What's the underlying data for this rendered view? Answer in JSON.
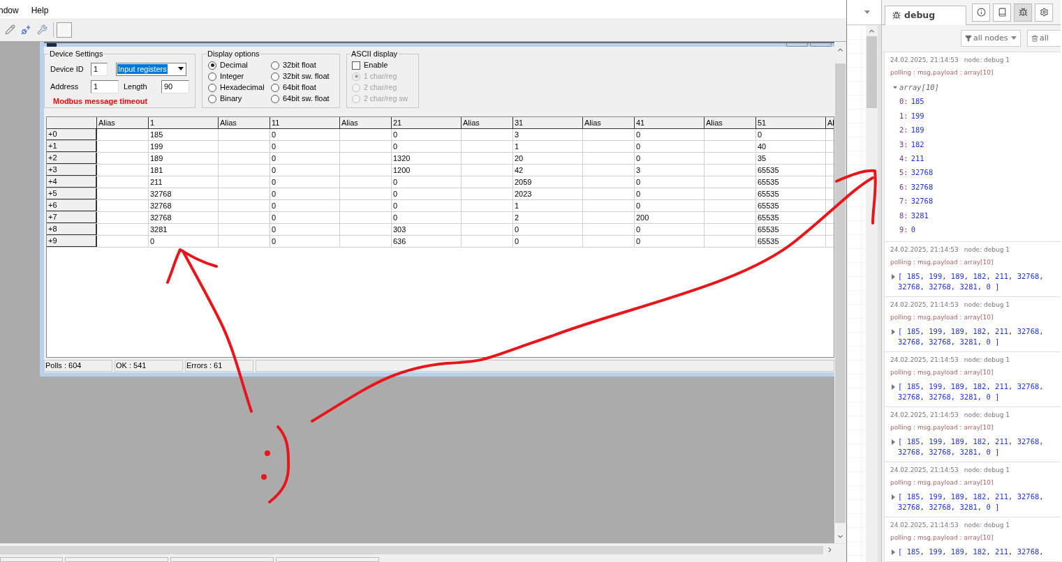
{
  "menu": [
    "ndow",
    "Help"
  ],
  "child_window": {
    "device_settings": {
      "title": "Device Settings",
      "device_id_label": "Device ID",
      "device_id": "1",
      "function": "Input registers",
      "address_label": "Address",
      "address": "1",
      "length_label": "Length",
      "length": "90",
      "error": "Modbus message timeout"
    },
    "display_options": {
      "title": "Display options",
      "options": [
        {
          "label": "Decimal",
          "selected": true
        },
        {
          "label": "Integer",
          "selected": false
        },
        {
          "label": "Hexadecimal",
          "selected": false
        },
        {
          "label": "Binary",
          "selected": false
        },
        {
          "label": "32bit float",
          "selected": false
        },
        {
          "label": "32bit sw. float",
          "selected": false
        },
        {
          "label": "64bit float",
          "selected": false
        },
        {
          "label": "64bit sw. float",
          "selected": false
        }
      ]
    },
    "ascii_display": {
      "title": "ASCII display",
      "enable": {
        "label": "Enable",
        "checked": false
      },
      "options": [
        {
          "label": "1 char/reg",
          "selected": true,
          "disabled": true
        },
        {
          "label": "2 char/reg",
          "selected": false,
          "disabled": true
        },
        {
          "label": "2 char/reg sw",
          "selected": false,
          "disabled": true
        }
      ]
    },
    "table": {
      "columns": [
        "Alias",
        "1",
        "Alias",
        "11",
        "Alias",
        "21",
        "Alias",
        "31",
        "Alias",
        "41",
        "Alias",
        "51",
        "Al"
      ],
      "rows": [
        {
          "label": "+0",
          "values": [
            "185",
            "0",
            "0",
            "3",
            "0",
            "0"
          ]
        },
        {
          "label": "+1",
          "values": [
            "199",
            "0",
            "0",
            "1",
            "0",
            "40"
          ]
        },
        {
          "label": "+2",
          "values": [
            "189",
            "0",
            "1320",
            "20",
            "0",
            "35"
          ]
        },
        {
          "label": "+3",
          "values": [
            "181",
            "0",
            "1200",
            "42",
            "3",
            "65535"
          ]
        },
        {
          "label": "+4",
          "values": [
            "211",
            "0",
            "0",
            "2059",
            "0",
            "65535"
          ]
        },
        {
          "label": "+5",
          "values": [
            "32768",
            "0",
            "0",
            "2023",
            "0",
            "65535"
          ]
        },
        {
          "label": "+6",
          "values": [
            "32768",
            "0",
            "0",
            "1",
            "0",
            "65535"
          ]
        },
        {
          "label": "+7",
          "values": [
            "32768",
            "0",
            "0",
            "2",
            "200",
            "65535"
          ]
        },
        {
          "label": "+8",
          "values": [
            "3281",
            "0",
            "303",
            "0",
            "0",
            "65535"
          ]
        },
        {
          "label": "+9",
          "values": [
            "0",
            "0",
            "636",
            "0",
            "0",
            "65535"
          ]
        }
      ]
    },
    "status_bar": [
      "Polls : 604",
      "OK : 541",
      "Errors : 61"
    ]
  },
  "debug_panel": {
    "tab": {
      "label": "debug",
      "selected": true
    },
    "tool_buttons": [
      {
        "kind": "info",
        "selected": false
      },
      {
        "kind": "book",
        "selected": false
      },
      {
        "kind": "bug",
        "selected": true
      },
      {
        "kind": "gear",
        "selected": false
      }
    ],
    "filter": "all nodes",
    "clear": "all",
    "messages": [
      {
        "time": "24.02.2025, 21:14:53",
        "node": "node: debug 1",
        "topic": "polling : msg.payload : array[10]",
        "expanded": true,
        "label": "array[10]",
        "items": [
          {
            "key": "0:",
            "value": "185"
          },
          {
            "key": "1:",
            "value": "199"
          },
          {
            "key": "2:",
            "value": "189"
          },
          {
            "key": "3:",
            "value": "182"
          },
          {
            "key": "4:",
            "value": "211"
          },
          {
            "key": "5:",
            "value": "32768"
          },
          {
            "key": "6:",
            "value": "32768"
          },
          {
            "key": "7:",
            "value": "32768"
          },
          {
            "key": "8:",
            "value": "3281"
          },
          {
            "key": "9:",
            "value": "0"
          }
        ]
      },
      {
        "time": "24.02.2025, 21:14:53",
        "node": "node: debug 1",
        "topic": "polling : msg.payload : array[10]",
        "expanded": false,
        "value": "[ 185, 199, 189, 182, 211, 32768, 32768, 32768, 3281, 0 ]"
      },
      {
        "time": "24.02.2025, 21:14:53",
        "node": "node: debug 1",
        "topic": "polling : msg.payload : array[10]",
        "expanded": false,
        "value": "[ 185, 199, 189, 182, 211, 32768, 32768, 32768, 3281, 0 ]"
      },
      {
        "time": "24.02.2025, 21:14:53",
        "node": "node: debug 1",
        "topic": "polling : msg.payload : array[10]",
        "expanded": false,
        "value": "[ 185, 199, 189, 182, 211, 32768, 32768, 32768, 3281, 0 ]"
      },
      {
        "time": "24.02.2025, 21:14:53",
        "node": "node: debug 1",
        "topic": "polling : msg.payload : array[10]",
        "expanded": false,
        "value": "[ 185, 199, 189, 182, 211, 32768, 32768, 32768, 3281, 0 ]"
      },
      {
        "time": "24.02.2025, 21:14:53",
        "node": "node: debug 1",
        "topic": "polling : msg.payload : array[10]",
        "expanded": false,
        "value": "[ 185, 199, 189, 182, 211, 32768, 32768, 32768, 3281, 0 ]"
      },
      {
        "time": "24.02.2025, 21:14:53",
        "node": "node: debug 1",
        "topic": "polling : msg.payload : array[10]",
        "expanded": false,
        "value": "[ 185, 199, 189, 182, 211, 32768,"
      }
    ]
  }
}
